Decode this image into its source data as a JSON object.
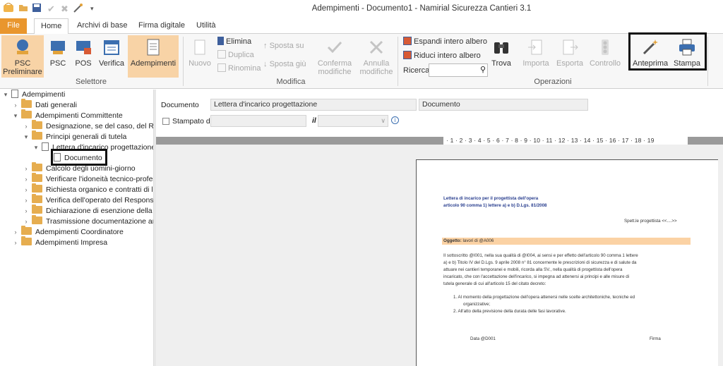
{
  "window": {
    "title": "Adempimenti - Documento1 - Namirial Sicurezza Cantieri 3.1"
  },
  "tabs": [
    "File",
    "Home",
    "Archivi di base",
    "Firma digitale",
    "Utilità"
  ],
  "ribbon": {
    "selettore": {
      "label": "Selettore",
      "psc_preliminare": "PSC Preliminare",
      "psc": "PSC",
      "pos": "POS",
      "verifica": "Verifica",
      "adempimenti": "Adempimenti"
    },
    "modifica": {
      "label": "Modifica",
      "nuovo": "Nuovo",
      "elimina": "Elimina",
      "duplica": "Duplica",
      "rinomina": "Rinomina",
      "sposta_su": "Sposta su",
      "sposta_giu": "Sposta giù",
      "conferma_1": "Conferma",
      "conferma_2": "modifiche",
      "annulla_1": "Annulla",
      "annulla_2": "modifiche"
    },
    "operazioni": {
      "label": "Operazioni",
      "espandi": "Espandi intero albero",
      "riduci": "Riduci intero albero",
      "ricerca": "Ricerca",
      "trova": "Trova",
      "importa": "Importa",
      "esporta": "Esporta",
      "controllo": "Controllo",
      "anteprima": "Anteprima",
      "stampa": "Stampa"
    }
  },
  "tree": {
    "root": "Adempimenti",
    "dati_generali": "Dati generali",
    "committente": "Adempimenti Committente",
    "designazione": "Designazione, se del caso, del Respor",
    "principi": "Principi generali di tutela",
    "lettera": "Lettera d'incarico progettazione",
    "documento": "Documento",
    "calcolo": "Calcolo degli uomini-giorno",
    "verificare": "Verificare l'idoneità tecnico-profession",
    "richiesta": "Richiesta organico e contratti di lavorc",
    "verifica_operato": "Verifica dell'operato del Responsabile",
    "dichiarazione": "Dichiarazione di esenzione della nomin",
    "trasmissione": "Trasmissione documentazione amminis",
    "coordinatore": "Adempimenti Coordinatore",
    "impresa": "Adempimenti Impresa"
  },
  "form": {
    "documento_label": "Documento",
    "documento_value": "Lettera d'incarico progettazione",
    "tipo_value": "Documento",
    "stampato_da_label": "Stampato da",
    "info_letter": "il"
  },
  "ruler": "· 1 · 2 · 3 · 4 · 5 · 6 · 7 · 8 · 9 · 10 · 11 · 12 · 13 · 14 · 15 · 16 · 17 · 18 · 19",
  "preview": {
    "heading_1": "Lettera di incarico per il progettista dell'opera",
    "heading_2": "articolo 90 comma 1) lettere a) e b) D.Lgs. 81/2008",
    "addressee": "Spett.le progettista <<....>>",
    "oggetto_label": "Oggetto:",
    "oggetto_text": "lavori di @A006",
    "body_1": "Il sottoscritto @I001, nella sua qualità di @I004, ai sensi e per effetto dell'articolo 90 comma 1 lettere",
    "body_2": "a) e b) Titolo IV del D.Lgs. 9 aprile 2008 n° 81 concernente le prescrizioni di sicurezza e di salute da",
    "body_3": "attuare nei cantieri temporanei e mobili, ricorda alla SV., nella qualità di progettista dell'opera",
    "body_4": "incaricato, che con l'accettazione dell'incarico, si impegna ad attenersi ai principi e alle misure di",
    "body_5": "tutela generale di cui all'articolo 15 del citato decreto:",
    "item_1a": "1.   Al momento della progettazione dell'opera attenersi nelle scelte architettoniche, tecniche ed",
    "item_1b": "organizzative;",
    "item_2": "2.   All'atto della previsione della durata delle fasi lavorative.",
    "data": "Data @D001",
    "firma": "Firma"
  },
  "colors": {
    "file_tab": "#e9962d",
    "highlight_button": "#f8d3a6",
    "folder": "#e6ad4f",
    "oggetto_band": "#fbd2a4",
    "heading_blue": "#2a3f8f"
  }
}
